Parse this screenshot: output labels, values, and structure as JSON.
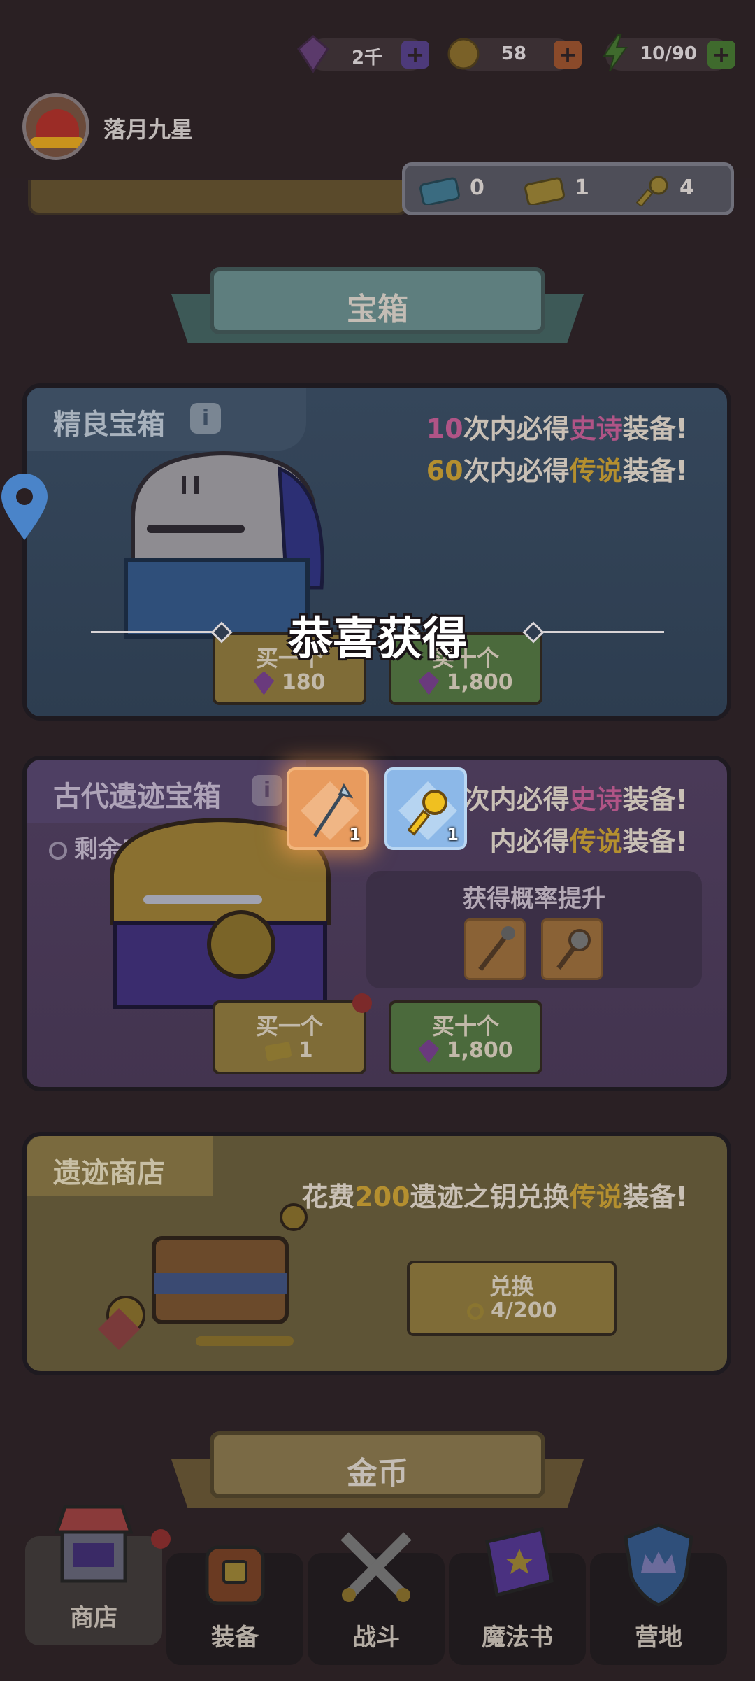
{
  "header": {
    "gems": "2千",
    "coins": "58",
    "energy": "10/90",
    "username": "落月九星",
    "tickets": {
      "blue": "0",
      "gold": "1",
      "keys": "4"
    }
  },
  "sections": {
    "chests_title": "宝箱",
    "coins_title": "金币"
  },
  "fine_chest": {
    "title": "精良宝箱",
    "line1_num": "10",
    "line1_pre": "次内必得",
    "line1_hl": "史诗",
    "line1_post": "装备!",
    "line2_num": "60",
    "line2_pre": "次内必得",
    "line2_hl": "传说",
    "line2_post": "装备!",
    "buy_one_label": "买一个",
    "buy_one_price": "180",
    "buy_ten_label": "买十个",
    "buy_ten_price": "1,800"
  },
  "ancient_chest": {
    "title": "古代遗迹宝箱",
    "remaining": "剩余5天",
    "line1_pre": "次内必得",
    "line1_hl": "史诗",
    "line1_post": "装备!",
    "line2_pre": "内必得",
    "line2_hl": "传说",
    "line2_post": "装备!",
    "prob_title": "获得概率提升",
    "buy_one_label": "买一个",
    "buy_one_price": "1",
    "buy_ten_label": "买十个",
    "buy_ten_price": "1,800"
  },
  "relic_shop": {
    "title": "遗迹商店",
    "desc_pre": "花费",
    "desc_num": "200",
    "desc_mid": "遗迹之钥兑换",
    "desc_hl": "传说",
    "desc_post": "装备!",
    "exchange_label": "兑换",
    "exchange_progress": "4/200"
  },
  "popup": {
    "title": "恭喜获得",
    "rewards": [
      {
        "icon": "arrow-weapon-icon",
        "qty": "1"
      },
      {
        "icon": "key-icon",
        "qty": "1"
      }
    ]
  },
  "nav": {
    "items": [
      {
        "label": "商店"
      },
      {
        "label": "装备"
      },
      {
        "label": "战斗"
      },
      {
        "label": "魔法书"
      },
      {
        "label": "营地"
      }
    ]
  }
}
